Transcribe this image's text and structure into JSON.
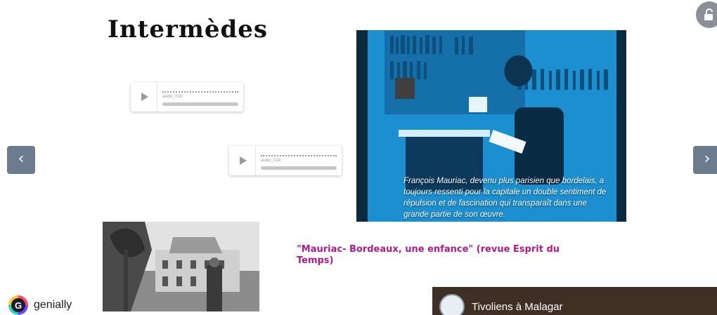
{
  "slide": {
    "title": "Intermèdes"
  },
  "audio_players": [
    {
      "name": "audio_019"
    },
    {
      "name": "audio_018"
    }
  ],
  "nav": {
    "prev_label": "‹",
    "next_label": "›"
  },
  "video": {
    "caption": "François Mauriac, devenu plus parisien que bordelais, a toujours ressenti pour la capitale un double sentiment de répulsion et de fascination qui transparaît dans une grande partie de son œuvre."
  },
  "link_text": "\"Mauriac- Bordeaux, une enfance\" (revue Esprit du Temps)",
  "youtube": {
    "title": "Tivoliens à Malagar"
  },
  "brand": {
    "name": "genially",
    "logo_letter": "G"
  },
  "colors": {
    "accent": "#b01a8c",
    "video_tint": "#1b8fd0",
    "nav_button": "#6d7b8e"
  }
}
